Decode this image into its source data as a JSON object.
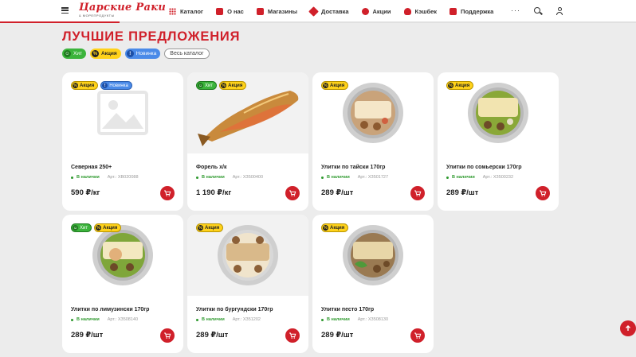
{
  "header": {
    "logo_main": "Царские Раки",
    "logo_sub": "& МОРЕПРОДУКТЫ",
    "nav": [
      {
        "label": "Каталог",
        "icon": "catalog-grid-icon"
      },
      {
        "label": "О нас",
        "icon": "about-icon"
      },
      {
        "label": "Магазины",
        "icon": "stores-icon"
      },
      {
        "label": "Доставка",
        "icon": "delivery-icon"
      },
      {
        "label": "Акции",
        "icon": "promo-icon"
      },
      {
        "label": "Кэшбек",
        "icon": "cashback-icon"
      },
      {
        "label": "Поддержка",
        "icon": "support-icon"
      }
    ],
    "more_label": "···"
  },
  "page_title": "ЛУЧШИЕ ПРЕДЛОЖЕНИЯ",
  "filters": {
    "hit": "Хит",
    "promo": "Акция",
    "new": "Новинка",
    "all": "Весь каталог"
  },
  "products": [
    {
      "name": "Северная 250+",
      "stock": "В наличии",
      "article": "Арт.: ХВ020088",
      "price": "590 ₽/кг",
      "badges": [
        "promo",
        "new"
      ]
    },
    {
      "name": "Форель х/к",
      "stock": "В наличии",
      "article": "Арт.: ХЗ500400",
      "price": "1 190 ₽/кг",
      "badges": [
        "hit",
        "promo"
      ]
    },
    {
      "name": "Улитки по тайски 170гр",
      "stock": "В наличии",
      "article": "Арт.: ХЗ501727",
      "price": "289 ₽/шт",
      "badges": [
        "promo"
      ]
    },
    {
      "name": "Улитки по сомьерски 170гр",
      "stock": "В наличии",
      "article": "Арт.: ХЗ500232",
      "price": "289 ₽/шт",
      "badges": [
        "promo"
      ]
    },
    {
      "name": "Улитки по лимузински 170гр",
      "stock": "В наличии",
      "article": "Арт.: ХЗ508140",
      "price": "289 ₽/шт",
      "badges": [
        "hit",
        "promo"
      ]
    },
    {
      "name": "Улитки по бургундски 170гр",
      "stock": "В наличии",
      "article": "Арт.: ХЗ51202",
      "price": "289 ₽/шт",
      "badges": [
        "promo"
      ]
    },
    {
      "name": "Улитки песто 170гр",
      "stock": "В наличии",
      "article": "Арт.: ХЗ508130",
      "price": "289 ₽/шт",
      "badges": [
        "promo"
      ]
    }
  ],
  "colors": {
    "brand_red": "#d0202a",
    "hit_green": "#3cb43c",
    "promo_yellow": "#ffd21a",
    "new_blue": "#4a8ae8"
  }
}
